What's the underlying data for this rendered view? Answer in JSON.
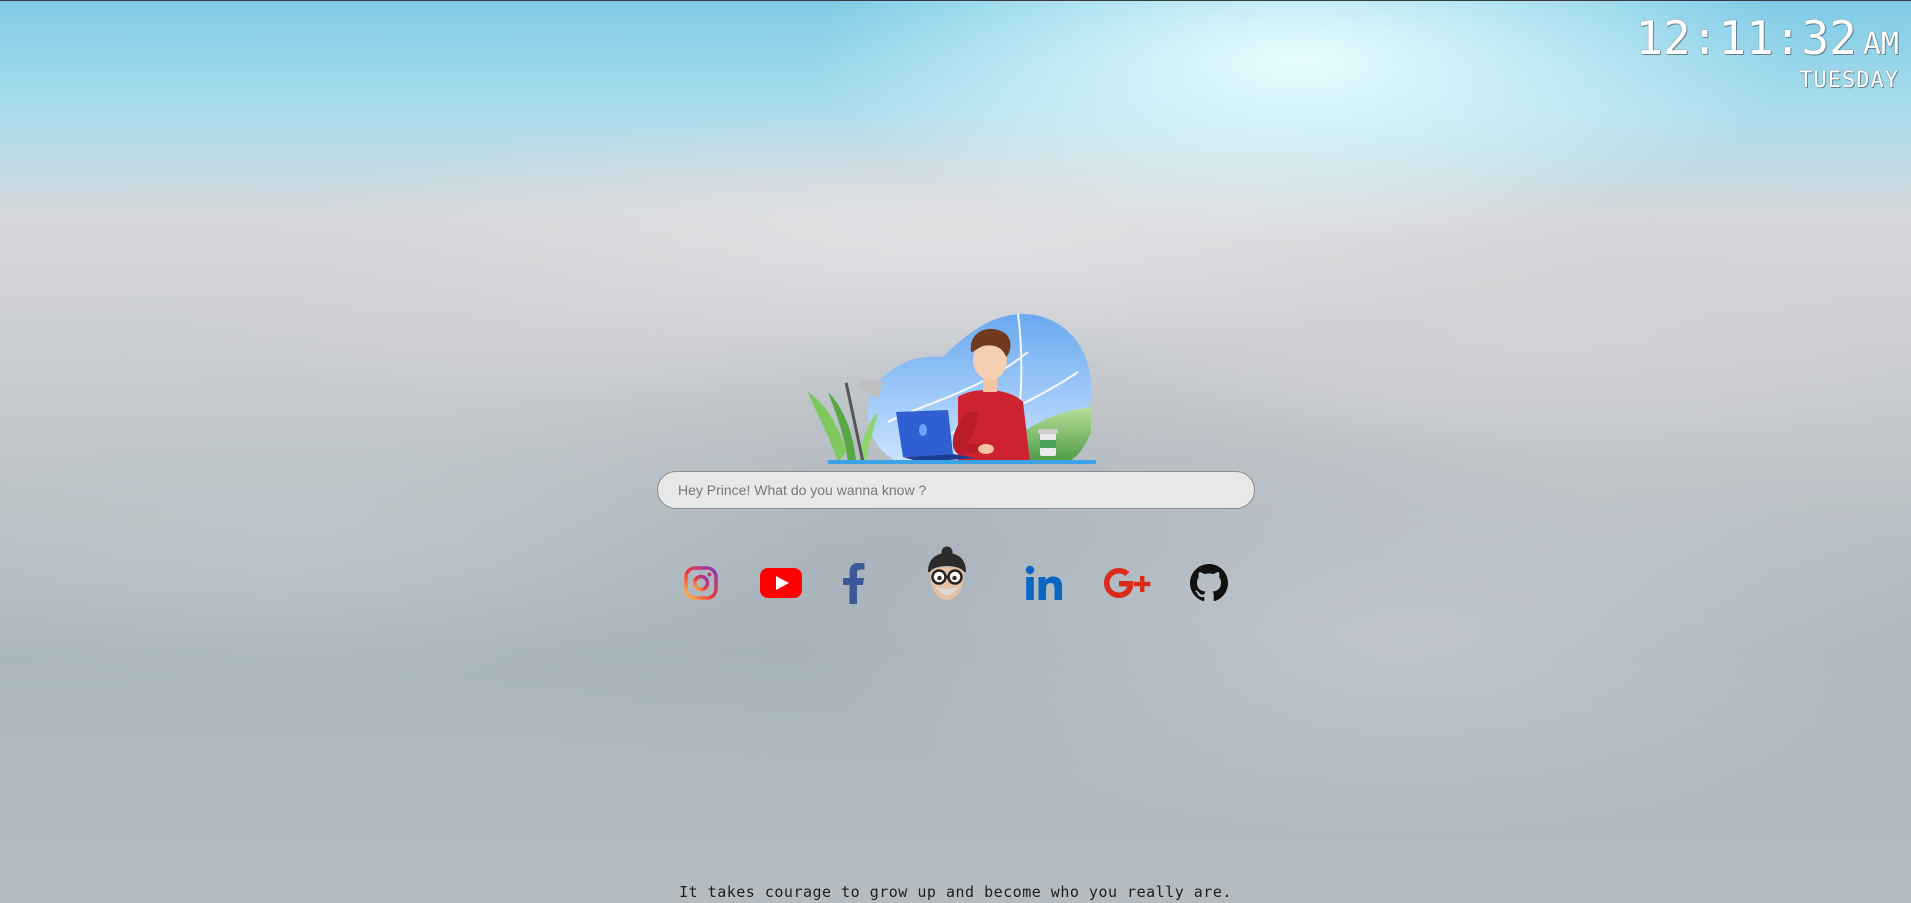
{
  "clock": {
    "time": "12:11:32",
    "ampm": "AM",
    "day": "TUESDAY"
  },
  "search": {
    "placeholder": "Hey Prince! What do you wanna know ?",
    "value": ""
  },
  "socials": [
    {
      "name": "instagram",
      "icon": "instagram-icon",
      "color": "#e4405f"
    },
    {
      "name": "youtube",
      "icon": "youtube-icon",
      "color": "#ff0000"
    },
    {
      "name": "facebook",
      "icon": "facebook-icon",
      "color": "#3b5998"
    },
    {
      "name": "avatar",
      "icon": "memoji-avatar-icon",
      "color": "#555555"
    },
    {
      "name": "linkedin",
      "icon": "linkedin-icon",
      "color": "#0a66c2"
    },
    {
      "name": "google-plus",
      "icon": "google-plus-icon",
      "color": "#db2a1c"
    },
    {
      "name": "github",
      "icon": "github-icon",
      "color": "#111111"
    }
  ],
  "hero": {
    "icon": "person-working-at-laptop-illustration"
  },
  "quote": "It takes courage to grow up and become who you really are."
}
